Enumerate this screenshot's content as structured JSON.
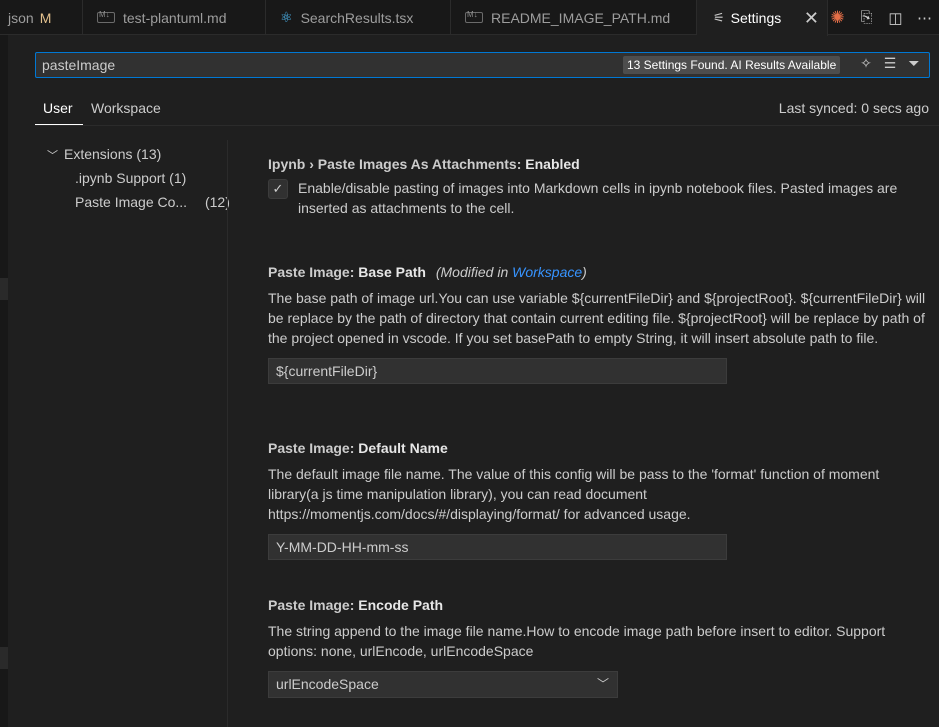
{
  "tabs": [
    {
      "label": "json",
      "modified": "M"
    },
    {
      "label": "test-plantuml.md"
    },
    {
      "label": "SearchResults.tsx"
    },
    {
      "label": "README_IMAGE_PATH.md"
    },
    {
      "label": "Settings"
    }
  ],
  "search": {
    "value": "pasteImage",
    "count_badge": "13 Settings Found. AI Results Available"
  },
  "scope": {
    "user": "User",
    "workspace": "Workspace",
    "last_synced": "Last synced: 0 secs ago"
  },
  "toc": {
    "extensions": "Extensions (13)",
    "ipynb": ".ipynb Support (1)",
    "paste_image": "Paste Image Co...",
    "paste_image_count": "(12)"
  },
  "settings": {
    "attachments": {
      "category": "Ipynb › Paste Images As Attachments:",
      "name": "Enabled",
      "checked": true,
      "description": "Enable/disable pasting of images into Markdown cells in ipynb notebook files. Pasted images are inserted as attachments to the cell."
    },
    "base_path": {
      "category": "Paste Image:",
      "name": "Base Path",
      "modified_prefix": "(Modified in ",
      "modified_link": "Workspace",
      "modified_suffix": ")",
      "description": "The base path of image url.You can use variable ${currentFileDir} and ${projectRoot}. ${currentFileDir} will be replace by the path of directory that contain current editing file. ${projectRoot} will be replace by path of the project opened in vscode. If you set basePath to empty String, it will insert absolute path to file.",
      "value": "${currentFileDir}"
    },
    "default_name": {
      "category": "Paste Image:",
      "name": "Default Name",
      "description": "The default image file name. The value of this config will be pass to the 'format' function of moment library(a js time manipulation library), you can read document https://momentjs.com/docs/#/displaying/format/ for advanced usage.",
      "value": "Y-MM-DD-HH-mm-ss"
    },
    "encode_path": {
      "category": "Paste Image:",
      "name": "Encode Path",
      "description": "The string append to the image file name.How to encode image path before insert to editor. Support options: none, urlEncode, urlEncodeSpace",
      "value": "urlEncodeSpace"
    }
  }
}
